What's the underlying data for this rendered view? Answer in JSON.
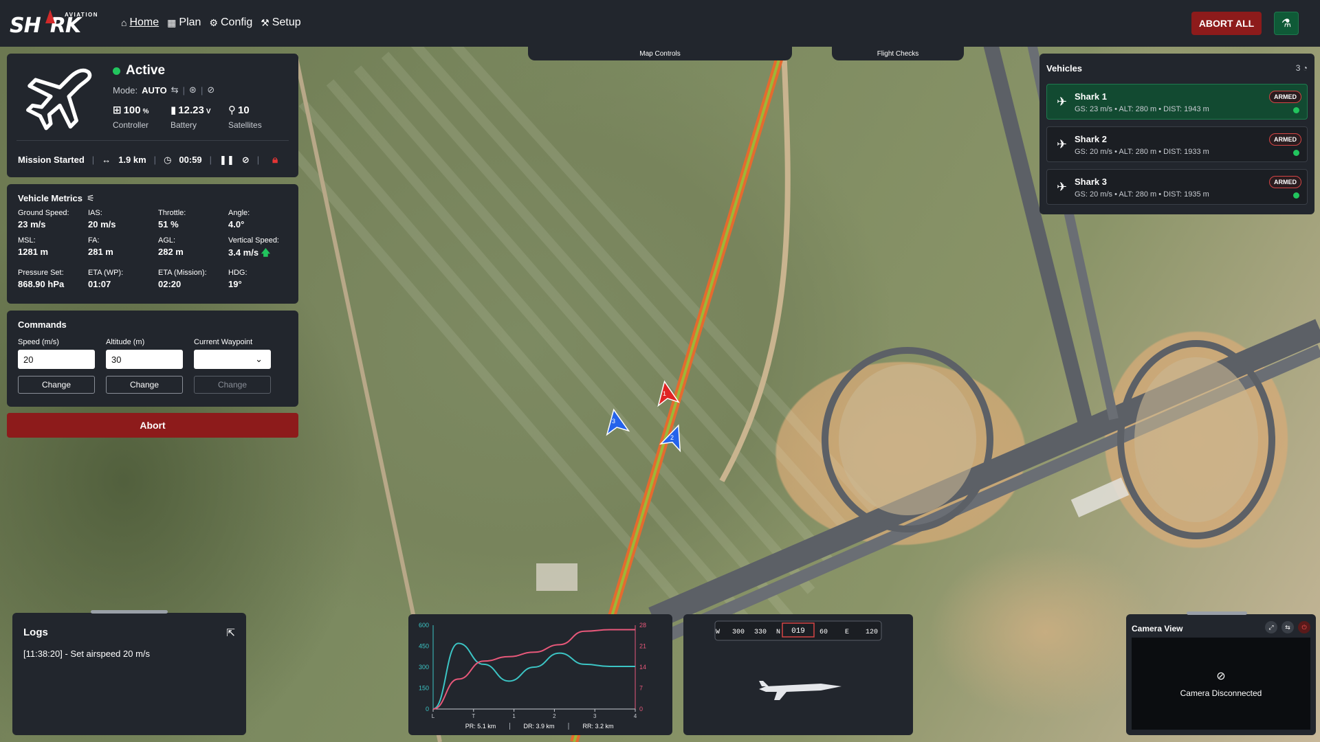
{
  "topbar": {
    "logo_word": "SH",
    "logo_word_end": "RK",
    "logo_sub": "AVIATION",
    "nav": [
      {
        "label": "Home",
        "icon": "home-icon",
        "glyph": "⌂"
      },
      {
        "label": "Plan",
        "icon": "map-icon",
        "glyph": "▦"
      },
      {
        "label": "Config",
        "icon": "gears-icon",
        "glyph": "⚙"
      },
      {
        "label": "Setup",
        "icon": "wrench-icon",
        "glyph": "⚒"
      }
    ],
    "abort_all": "ABORT ALL",
    "settings_glyph": "⚗"
  },
  "map_tabs": {
    "map_controls": "Map Controls",
    "flight_checks": "Flight Checks"
  },
  "status": {
    "state": "Active",
    "mode_label": "Mode:",
    "mode": "AUTO",
    "controller_value": "100",
    "controller_unit": "%",
    "controller_label": "Controller",
    "battery_value": "12.23",
    "battery_unit": "V",
    "battery_label": "Battery",
    "satellites_value": "10",
    "satellites_label": "Satellites",
    "mission": "Mission Started",
    "distance": "1.9 km",
    "timer": "00:59"
  },
  "metrics": {
    "title": "Vehicle Metrics",
    "items": [
      {
        "label": "Ground Speed:",
        "value": "23 m/s"
      },
      {
        "label": "IAS:",
        "value": "20 m/s"
      },
      {
        "label": "Throttle:",
        "value": "51 %"
      },
      {
        "label": "Angle:",
        "value": "4.0°"
      },
      {
        "label": "MSL:",
        "value": "1281 m"
      },
      {
        "label": "FA:",
        "value": "281 m"
      },
      {
        "label": "AGL:",
        "value": "282 m"
      },
      {
        "label": "Vertical Speed:",
        "value": "3.4 m/s"
      },
      {
        "label": "Pressure Set:",
        "value": "868.90 hPa"
      },
      {
        "label": "ETA (WP):",
        "value": "01:07"
      },
      {
        "label": "ETA (Mission):",
        "value": "02:20"
      },
      {
        "label": "HDG:",
        "value": "19°"
      }
    ]
  },
  "commands": {
    "title": "Commands",
    "speed_label": "Speed (m/s)",
    "speed_value": "20",
    "altitude_label": "Altitude (m)",
    "altitude_value": "30",
    "waypoint_label": "Current Waypoint",
    "change_label": "Change"
  },
  "abort_label": "Abort",
  "vehicles": {
    "title": "Vehicles",
    "count": "3",
    "list": [
      {
        "name": "Shark 1",
        "info": "GS: 23 m/s • ALT: 280 m • DIST: 1943 m",
        "badge": "ARMED"
      },
      {
        "name": "Shark 2",
        "info": "GS: 20 m/s • ALT: 280 m • DIST: 1933 m",
        "badge": "ARMED"
      },
      {
        "name": "Shark 3",
        "info": "GS: 20 m/s • ALT: 280 m • DIST: 1935 m",
        "badge": "ARMED"
      }
    ]
  },
  "map_markers": [
    {
      "label": "1",
      "color": "#e02424"
    },
    {
      "label": "2",
      "color": "#2563eb"
    },
    {
      "label": "3",
      "color": "#2563eb"
    }
  ],
  "logs": {
    "title": "Logs",
    "entries": [
      "[11:38:20] - Set airspeed 20 m/s"
    ]
  },
  "chart_data": {
    "type": "line",
    "x_ticks": [
      "L",
      "T",
      "1",
      "2",
      "3",
      "4"
    ],
    "y_left_ticks": [
      "0",
      "150",
      "300",
      "450",
      "600"
    ],
    "y_right_ticks": [
      "0",
      "7",
      "14",
      "21",
      "28"
    ],
    "ylim_left": [
      0,
      600
    ],
    "ylim_right": [
      0,
      28
    ],
    "series": [
      {
        "color": "#3cc5c5",
        "axis": "left",
        "x": [
          0,
          0.5,
          1,
          1.5,
          2,
          2.5,
          3,
          3.5,
          4
        ],
        "values": [
          0,
          470,
          320,
          200,
          300,
          400,
          320,
          305,
          305
        ]
      },
      {
        "color": "#e8587a",
        "axis": "right",
        "x": [
          0,
          0.5,
          1,
          1.5,
          2,
          2.5,
          3,
          3.5,
          4
        ],
        "values": [
          0,
          10,
          16,
          17.5,
          19,
          21.5,
          26,
          26.5,
          26.5
        ]
      }
    ],
    "footer": [
      "PR: 5.1 km",
      "DR: 3.9 km",
      "RR: 3.2 km"
    ]
  },
  "compass": {
    "ticks": [
      "W",
      "300",
      "330",
      "N",
      "019",
      "60",
      "E",
      "120"
    ],
    "heading": "019"
  },
  "camera": {
    "title": "Camera View",
    "status": "Camera Disconnected"
  },
  "colors": {
    "accent_green": "#22c55e",
    "danger": "#8d1b1b",
    "panel": "#22262d"
  }
}
